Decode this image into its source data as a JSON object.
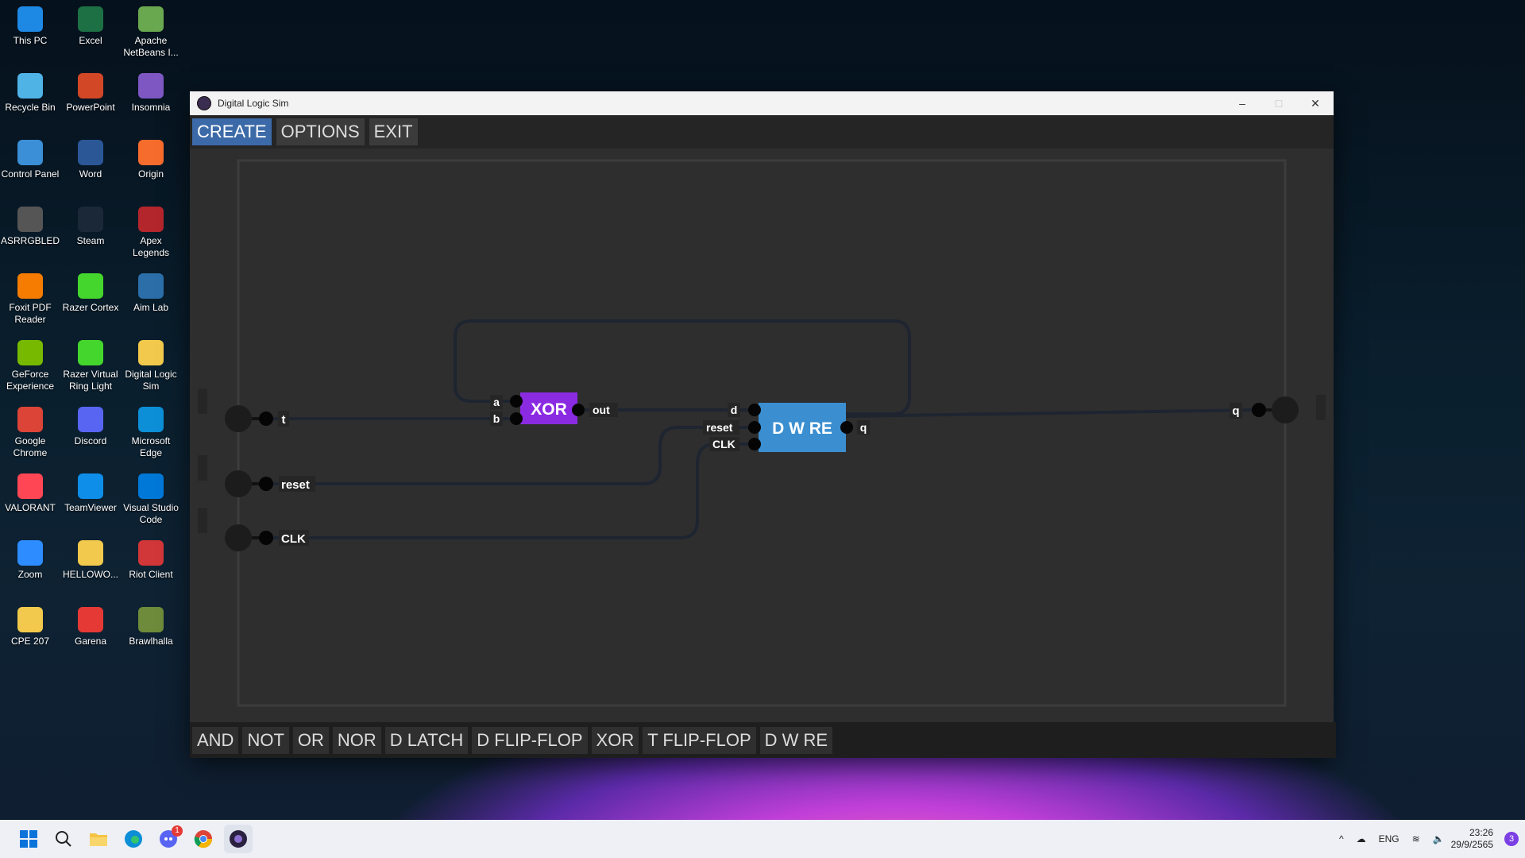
{
  "desktop": {
    "icons": [
      {
        "label": "This PC",
        "color": "#1e88e5"
      },
      {
        "label": "Excel",
        "color": "#1d7044"
      },
      {
        "label": "Apache NetBeans I...",
        "color": "#6aa84f"
      },
      {
        "label": "Recycle Bin",
        "color": "#4fb3e6"
      },
      {
        "label": "PowerPoint",
        "color": "#d24726"
      },
      {
        "label": "Insomnia",
        "color": "#7e57c2"
      },
      {
        "label": "Control Panel",
        "color": "#3a8fd6"
      },
      {
        "label": "Word",
        "color": "#2b5797"
      },
      {
        "label": "Origin",
        "color": "#f56c2d"
      },
      {
        "label": "ASRRGBLED",
        "color": "#555555"
      },
      {
        "label": "Steam",
        "color": "#1b2838"
      },
      {
        "label": "Apex Legends",
        "color": "#b3262c"
      },
      {
        "label": "Foxit PDF Reader",
        "color": "#f57c00"
      },
      {
        "label": "Razer Cortex",
        "color": "#44d62c"
      },
      {
        "label": "Aim Lab",
        "color": "#2b6ea8"
      },
      {
        "label": "GeForce Experience",
        "color": "#76b900"
      },
      {
        "label": "Razer Virtual Ring Light",
        "color": "#44d62c"
      },
      {
        "label": "Digital Logic Sim",
        "color": "#f2c94c"
      },
      {
        "label": "Google Chrome",
        "color": "#db4437"
      },
      {
        "label": "Discord",
        "color": "#5865f2"
      },
      {
        "label": "Microsoft Edge",
        "color": "#0c8fd6"
      },
      {
        "label": "VALORANT",
        "color": "#ff4655"
      },
      {
        "label": "TeamViewer",
        "color": "#0e8ee9"
      },
      {
        "label": "Visual Studio Code",
        "color": "#0078d7"
      },
      {
        "label": "Zoom",
        "color": "#2d8cff"
      },
      {
        "label": "HELLOWO...",
        "color": "#f2c94c"
      },
      {
        "label": "Riot Client",
        "color": "#d13639"
      },
      {
        "label": "CPE 207",
        "color": "#f2c94c"
      },
      {
        "label": "Garena",
        "color": "#e53935"
      },
      {
        "label": "Brawlhalla",
        "color": "#6d8b3a"
      }
    ]
  },
  "window": {
    "title": "Digital Logic Sim",
    "menu": [
      "CREATE",
      "OPTIONS",
      "EXIT"
    ],
    "bottom_buttons": [
      "AND",
      "NOT",
      "OR",
      "NOR",
      "D LATCH",
      "D FLIP-FLOP",
      "XOR",
      "T FLIP-FLOP",
      "D W RE"
    ],
    "inputs": [
      "t",
      "reset",
      "CLK"
    ],
    "output": "q",
    "xor_chip": {
      "name": "XOR",
      "pin_a": "a",
      "pin_b": "b",
      "pin_out": "out",
      "color": "#8a2be2"
    },
    "dwre_chip": {
      "name": "D W RE",
      "pin_d": "d",
      "pin_reset": "reset",
      "pin_clk": "CLK",
      "pin_q": "q",
      "color": "#3b8fd0"
    }
  },
  "taskbar": {
    "lang": "ENG",
    "time": "23:26",
    "date": "29/9/2565",
    "notification_count": "3",
    "discord_badge": "1"
  }
}
